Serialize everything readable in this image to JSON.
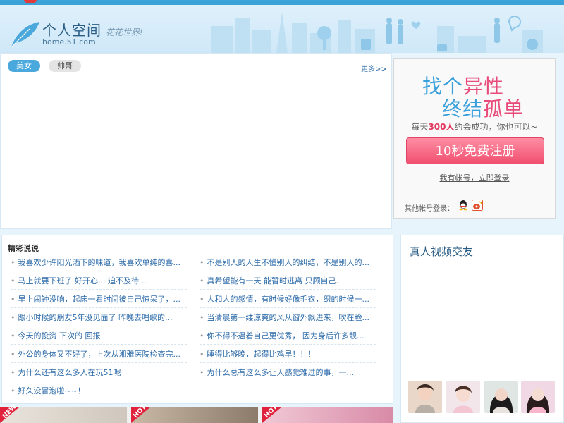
{
  "header": {
    "logo_text": "个人空间",
    "logo_url": "home.51.com",
    "slogan": "花花世界!"
  },
  "gallery": {
    "tabs": [
      {
        "label": "美女",
        "active": true
      },
      {
        "label": "帅哥",
        "active": false
      }
    ],
    "more_label": "更多>>"
  },
  "register": {
    "headline_a": "找个",
    "headline_b": "异性",
    "headline_c": "终结",
    "headline_d": "孤单",
    "desc_prefix": "每天",
    "desc_num": "300人",
    "desc_suffix": "约会成功，你也可以~",
    "button_label": "10秒免费注册",
    "login_link": "我有帐号，立即登录",
    "other_login_label": "其他帐号登录：",
    "colors": {
      "accent": "#3aa0dc",
      "pink": "#e84b7a",
      "button": "#f0506f"
    }
  },
  "talk": {
    "title": "精彩说说",
    "items_left": [
      "我喜欢少许阳光洒下的味道，我喜欢单纯的喜...",
      "马上就要下班了 好开心... 迫不及待 ..",
      "早上闹钟没响，起床一看时间被自己惊呆了，...",
      "跟小时候的朋友5年没见面了 昨晚去唱歌的...",
      "今天的投资   下次的 回报",
      "外公的身体又不好了，上次从湘雅医院检查完...",
      "为什么还有这么多人在玩51呢",
      "好久没冒泡啦~~！"
    ],
    "items_right": [
      "不是别人的人生不懂别人的纠结，不是别人的...",
      "真希望能有一天 能暂时逃离 只顾自己.",
      "人和人的感情，有时候好像毛衣，织的时候一...",
      "当清晨第一缕凉爽的风从窗外飘进来，吹在脸...",
      "你不得不逼着自己更优秀， 因为身后许多靓...",
      "睡得比够晚，起得比鸡早！！！",
      "为什么总有这么多让人感觉难过的事，一..."
    ]
  },
  "video": {
    "title": "真人视频交友"
  },
  "bottom": {
    "tags": [
      "NEW",
      "HOT",
      "HOT"
    ]
  }
}
